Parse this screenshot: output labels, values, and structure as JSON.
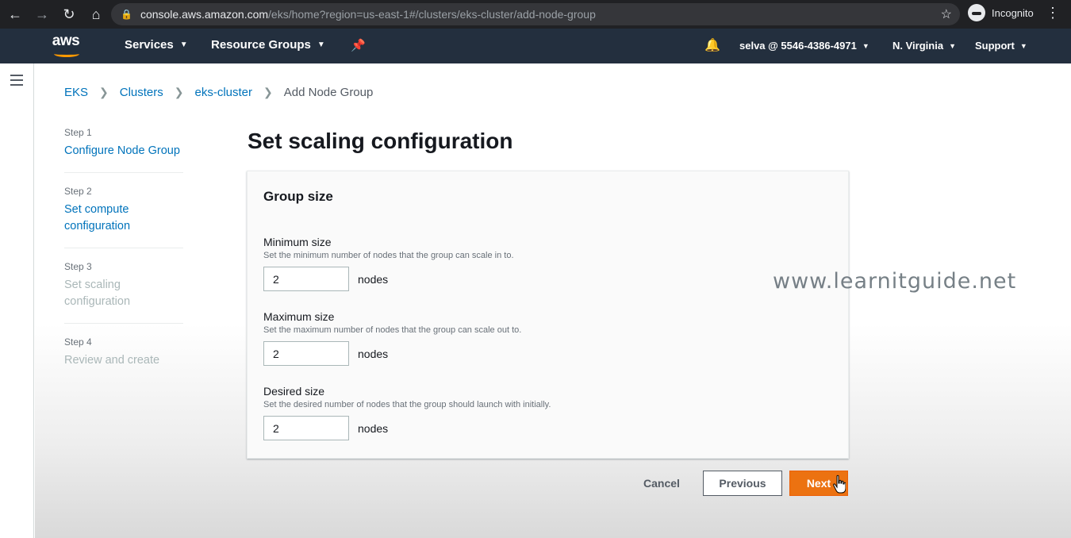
{
  "browser": {
    "url_host": "console.aws.amazon.com",
    "url_path": "/eks/home?region=us-east-1#/clusters/eks-cluster/add-node-group",
    "profile_label": "Incognito"
  },
  "navbar": {
    "logo_text": "aws",
    "services_label": "Services",
    "resource_groups_label": "Resource Groups",
    "account_label": "selva @ 5546-4386-4971",
    "region_label": "N. Virginia",
    "support_label": "Support",
    "accent_color": "#ff9900"
  },
  "breadcrumb": {
    "items": [
      "EKS",
      "Clusters",
      "eks-cluster"
    ],
    "current": "Add Node Group"
  },
  "steps": [
    {
      "num": "Step 1",
      "name": "Configure Node Group",
      "state": "link"
    },
    {
      "num": "Step 2",
      "name": "Set compute configuration",
      "state": "link"
    },
    {
      "num": "Step 3",
      "name": "Set scaling configuration",
      "state": "current"
    },
    {
      "num": "Step 4",
      "name": "Review and create",
      "state": "disabled"
    }
  ],
  "page": {
    "title": "Set scaling configuration"
  },
  "group_size": {
    "title": "Group size",
    "min": {
      "label": "Minimum size",
      "desc": "Set the minimum number of nodes that the group can scale in to.",
      "value": "2",
      "unit": "nodes"
    },
    "max": {
      "label": "Maximum size",
      "desc": "Set the maximum number of nodes that the group can scale out to.",
      "value": "2",
      "unit": "nodes"
    },
    "desired": {
      "label": "Desired size",
      "desc": "Set the desired number of nodes that the group should launch with initially.",
      "value": "2",
      "unit": "nodes"
    }
  },
  "footer": {
    "cancel_label": "Cancel",
    "previous_label": "Previous",
    "next_label": "Next",
    "next_color": "#ec7211"
  },
  "watermark": "www.learnitguide.net"
}
